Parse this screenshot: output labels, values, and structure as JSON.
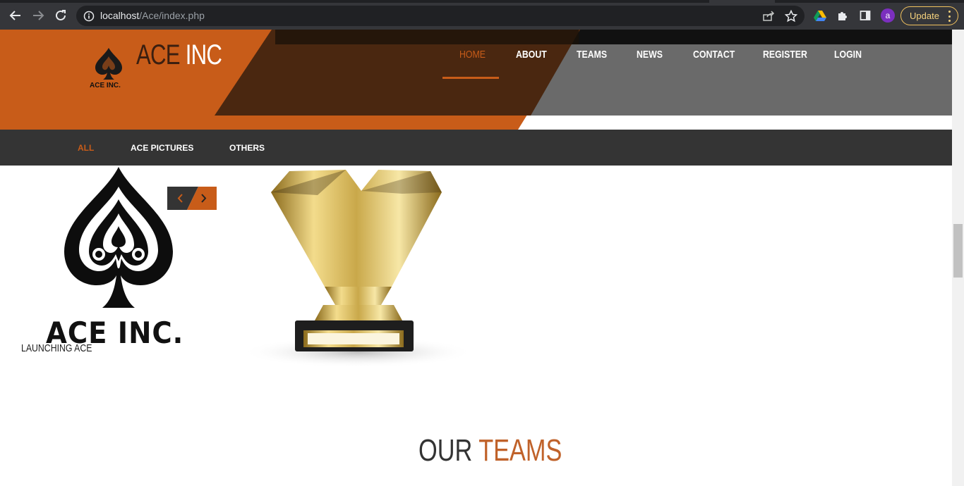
{
  "browser": {
    "url_host": "localhost",
    "url_path": "/Ace/index.php",
    "profile_initial": "a",
    "update_label": "Update"
  },
  "brand": {
    "title_part1": "ACE",
    "title_part2": "INC",
    "logo_text": "ACE INC."
  },
  "nav": {
    "items": [
      {
        "label": "HOME",
        "active": true
      },
      {
        "label": "ABOUT"
      },
      {
        "label": "TEAMS"
      },
      {
        "label": "NEWS"
      },
      {
        "label": "CONTACT"
      },
      {
        "label": "REGISTER"
      },
      {
        "label": "LOGIN"
      }
    ]
  },
  "filters": {
    "items": [
      {
        "label": "ALL",
        "active": true
      },
      {
        "label": "ACE PICTURES"
      },
      {
        "label": "OTHERS"
      }
    ]
  },
  "gallery": {
    "logo_text": "ACE INC.",
    "caption": "LAUNCHING ACE"
  },
  "teams": {
    "heading_part1": "OUR",
    "heading_part2": "TEAMS"
  },
  "colors": {
    "accent": "#c85c19",
    "dark_brown": "#4a2710",
    "gray": "#6a6a6a",
    "filter_bar": "#343434"
  }
}
